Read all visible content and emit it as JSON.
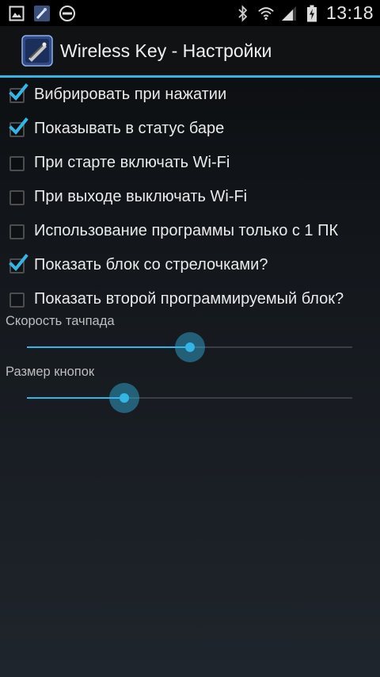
{
  "status_bar": {
    "time": "13:18",
    "left_icons": [
      "gallery-icon",
      "app-notification-icon",
      "do-not-disturb-icon"
    ],
    "right_icons": [
      "bluetooth-icon",
      "wifi-icon",
      "signal-icon",
      "battery-charging-icon"
    ]
  },
  "action_bar": {
    "title": "Wireless Key - Настройки",
    "icon": "wireless-key-app-icon"
  },
  "preferences": [
    {
      "label": "Вибрировать при нажатии",
      "checked": true
    },
    {
      "label": "Показывать в статус баре",
      "checked": true
    },
    {
      "label": "При старте включать Wi-Fi",
      "checked": false
    },
    {
      "label": "При выходе выключать Wi-Fi",
      "checked": false
    },
    {
      "label": "Использование программы только с 1 ПК",
      "checked": false
    },
    {
      "label": "Показать блок со стрелочками?",
      "checked": true
    },
    {
      "label": "Показать второй программируемый блок?",
      "checked": false
    }
  ],
  "sliders": [
    {
      "title": "Скорость тачпада",
      "fraction": 0.5
    },
    {
      "title": "Размер кнопок",
      "fraction": 0.3
    }
  ],
  "colors": {
    "accent": "#33b5e5",
    "checkbox_border": "#4d4d4d",
    "text": "#eaeaea"
  }
}
